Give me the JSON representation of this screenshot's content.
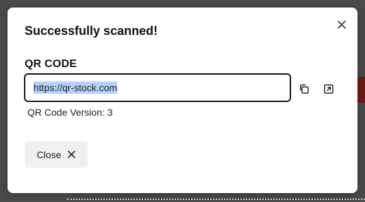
{
  "dialog": {
    "title": "Successfully scanned!",
    "close_icon": "close-icon"
  },
  "qr": {
    "section_label": "QR CODE",
    "value": "https://qr-stock.com",
    "copy_icon": "copy-icon",
    "open_icon": "open-external-icon",
    "version_text": "QR Code Version: 3"
  },
  "footer": {
    "close_label": "Close",
    "close_icon": "close-icon"
  },
  "colors": {
    "backdrop": "#4a4a4a",
    "accent_behind": "#6b1a12",
    "selection": "#b3d4fc",
    "button_bg": "#f0f0f0"
  }
}
